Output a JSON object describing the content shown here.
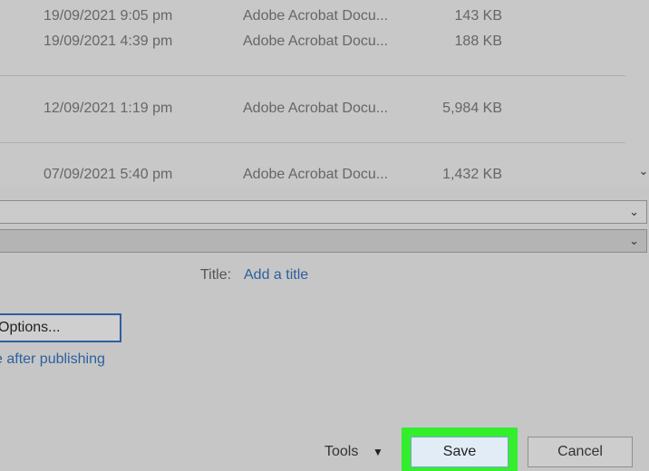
{
  "files": [
    {
      "date": "19/09/2021 9:05 pm",
      "type": "Adobe Acrobat Docu...",
      "size": "143 KB"
    },
    {
      "date": "19/09/2021 4:39 pm",
      "type": "Adobe Acrobat Docu...",
      "size": "188 KB"
    },
    {
      "date": "12/09/2021 1:19 pm",
      "type": "Adobe Acrobat Docu...",
      "size": "5,984 KB"
    },
    {
      "date": "07/09/2021 5:40 pm",
      "type": "Adobe Acrobat Docu...",
      "size": "1,432 KB"
    }
  ],
  "metadata": {
    "title_label": "Title:",
    "title_placeholder": "Add a title"
  },
  "options": {
    "button_label": "Options...",
    "open_after_label": "e after publishing"
  },
  "footer": {
    "tools_label": "Tools",
    "save_label": "Save",
    "cancel_label": "Cancel"
  },
  "colors": {
    "highlight": "#33ee2c",
    "link": "#2d5f9e",
    "save_bg": "#e1ecf6"
  }
}
